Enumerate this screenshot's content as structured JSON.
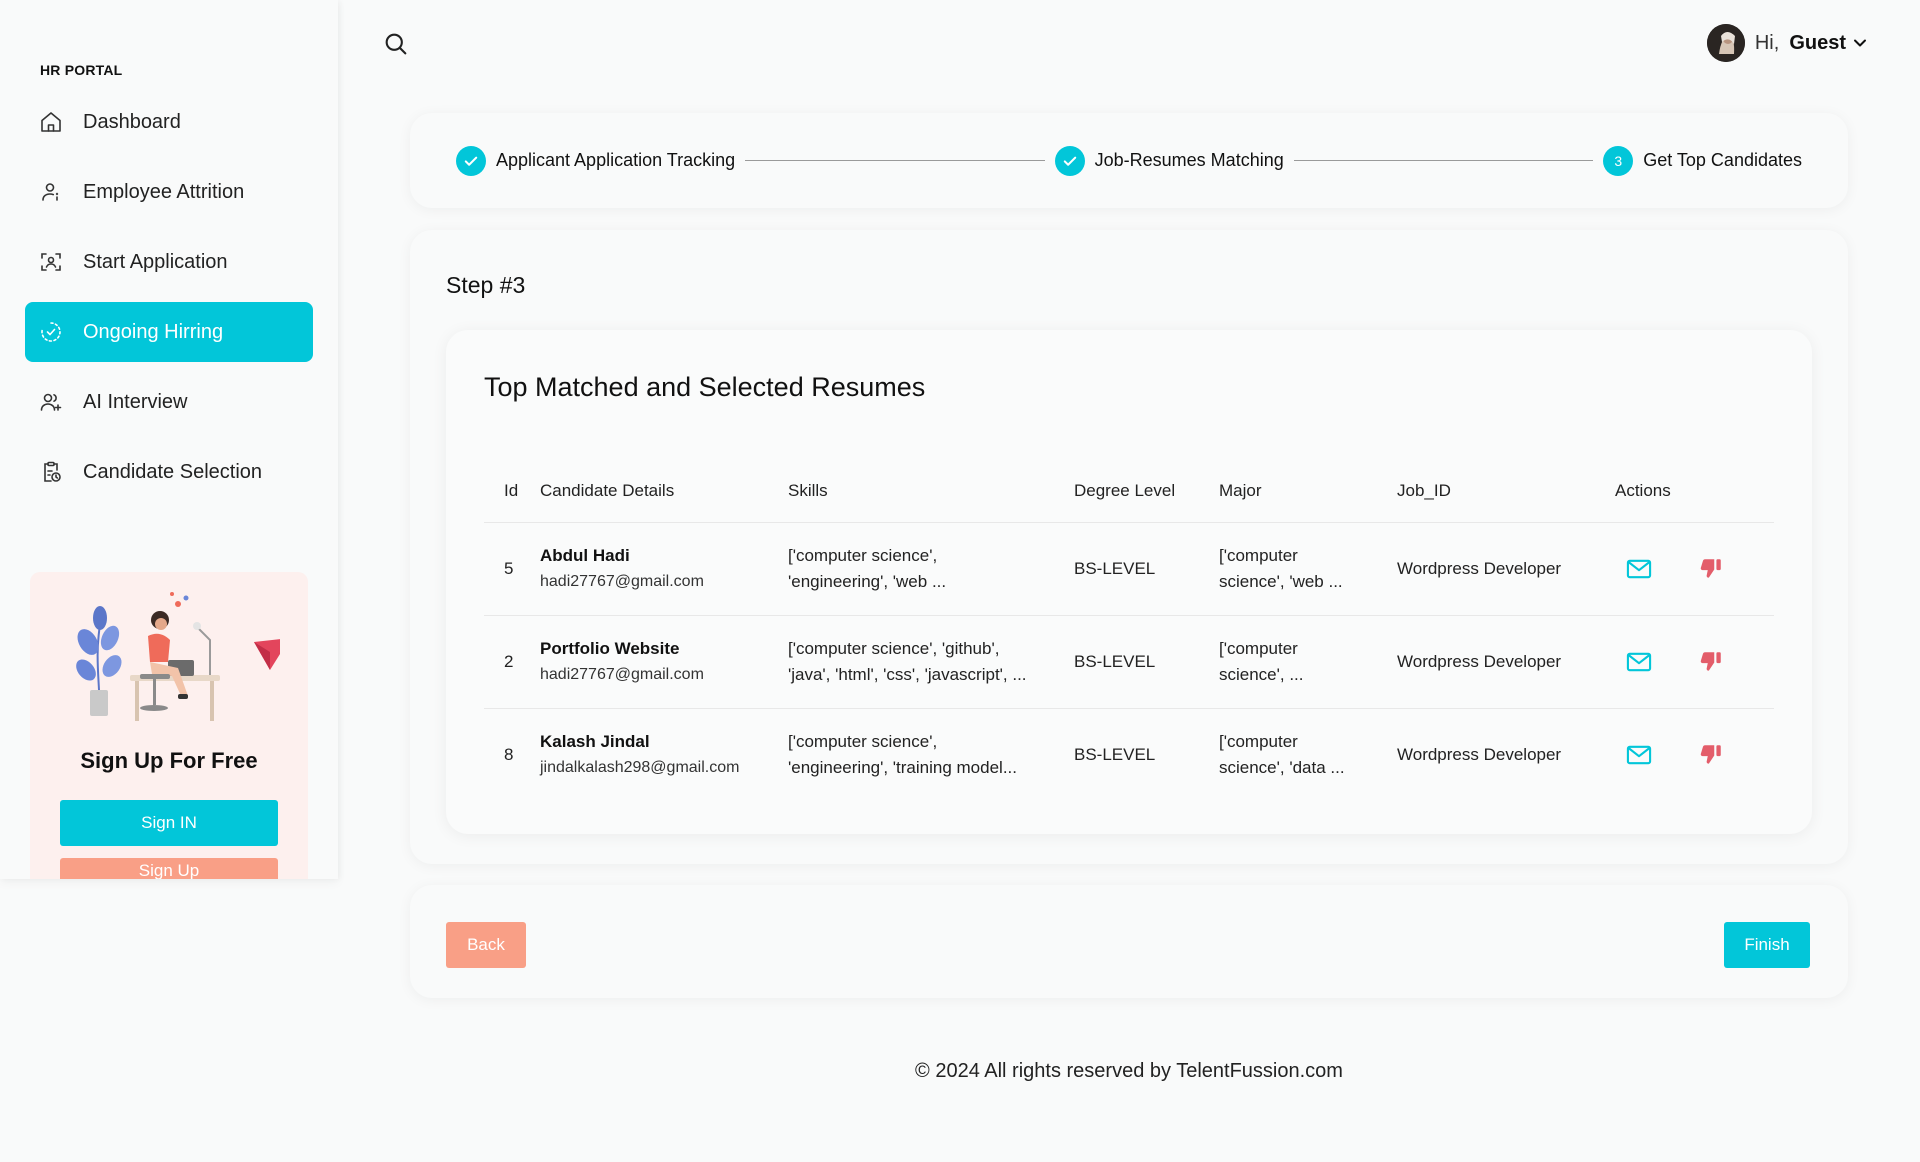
{
  "sidebar": {
    "brand": "HR PORTAL",
    "items": [
      {
        "label": "Dashboard",
        "icon": "home-icon"
      },
      {
        "label": "Employee Attrition",
        "icon": "user-icon"
      },
      {
        "label": "Start Application",
        "icon": "scan-user-icon"
      },
      {
        "label": "Ongoing Hirring",
        "icon": "progress-check-icon",
        "active": true
      },
      {
        "label": "AI Interview",
        "icon": "user-plus-icon"
      },
      {
        "label": "Candidate Selection",
        "icon": "clipboard-clock-icon"
      }
    ],
    "promo": {
      "title": "Sign Up For Free",
      "signin_label": "Sign IN",
      "signup_label": "Sign Up"
    }
  },
  "header": {
    "greeting": "Hi,",
    "username": "Guest"
  },
  "stepper": {
    "steps": [
      {
        "label": "Applicant Application Tracking",
        "status": "done"
      },
      {
        "label": "Job-Resumes Matching",
        "status": "done"
      },
      {
        "label": "Get Top Candidates",
        "status": "current",
        "number": "3"
      }
    ]
  },
  "main": {
    "step_title": "Step #3",
    "table_title": "Top Matched and Selected Resumes",
    "columns": [
      "Id",
      "Candidate Details",
      "Skills",
      "Degree Level",
      "Major",
      "Job_ID",
      "Actions"
    ],
    "rows": [
      {
        "id": "5",
        "name": "Abdul Hadi",
        "email": "hadi27767@gmail.com",
        "skills_1": "['computer science',",
        "skills_2": "'engineering', 'web ...",
        "degree": "BS-LEVEL",
        "major_1": "['computer",
        "major_2": "science', 'web ...",
        "job": "Wordpress Developer"
      },
      {
        "id": "2",
        "name": "Portfolio Website",
        "email": "hadi27767@gmail.com",
        "skills_1": "['computer science', 'github',",
        "skills_2": "'java', 'html', 'css', 'javascript', ...",
        "degree": "BS-LEVEL",
        "major_1": "['computer",
        "major_2": "science', ...",
        "job": "Wordpress Developer"
      },
      {
        "id": "8",
        "name": "Kalash Jindal",
        "email": "jindalkalash298@gmail.com",
        "skills_1": "['computer science',",
        "skills_2": "'engineering', 'training model...",
        "degree": "BS-LEVEL",
        "major_1": "['computer",
        "major_2": "science', 'data ...",
        "job": "Wordpress Developer"
      }
    ]
  },
  "footer": {
    "back_label": "Back",
    "finish_label": "Finish",
    "copyright": "© 2024 All rights reserved by TelentFussion.com"
  },
  "colors": {
    "accent": "#02c6d9",
    "secondary": "#f99f86",
    "dislike": "#e35d6a"
  }
}
